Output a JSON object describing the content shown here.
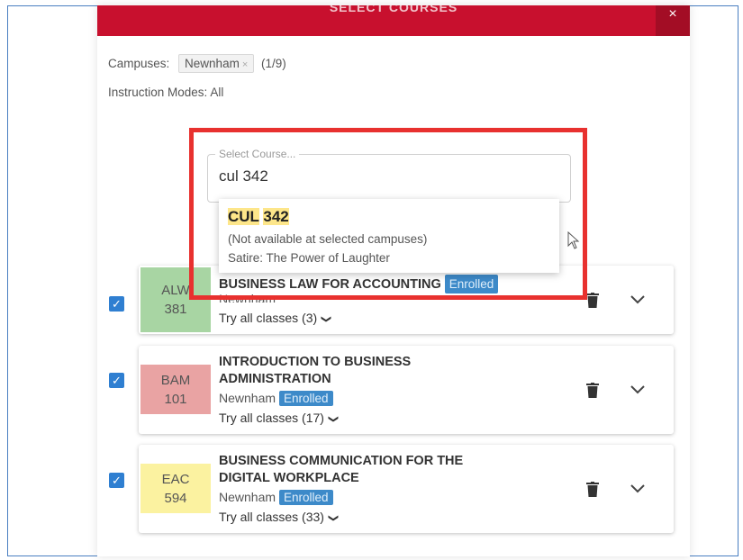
{
  "header": {
    "title": "SELECT COURSES",
    "close_label": "×"
  },
  "filters": {
    "campuses_label": "Campuses:",
    "campus_chip": "Newnham",
    "campus_chip_remove": "×",
    "campus_count": "(1/9)",
    "modes_label": "Instruction Modes:",
    "modes_value": "All"
  },
  "search": {
    "label": "Select Course...",
    "value": "cul 342"
  },
  "suggestion": {
    "code_part1": "CUL",
    "code_part2": "342",
    "note": "(Not available at selected campuses)",
    "title": "Satire: The Power of Laughter"
  },
  "courses": [
    {
      "subject": "ALW",
      "number": "381",
      "title": "BUSINESS LAW FOR ACCOUNTING",
      "campus": "Newnham",
      "badge": "Enrolled",
      "try_all": "Try all classes (3)",
      "color": "#a8d5a3"
    },
    {
      "subject": "BAM",
      "number": "101",
      "title": "INTRODUCTION TO BUSINESS ADMINISTRATION",
      "campus": "Newnham",
      "badge": "Enrolled",
      "try_all": "Try all classes (17)",
      "color": "#e9a3a3"
    },
    {
      "subject": "EAC",
      "number": "594",
      "title": "BUSINESS COMMUNICATION FOR THE DIGITAL WORKPLACE",
      "campus": "Newnham",
      "badge": "Enrolled",
      "try_all": "Try all classes (33)",
      "color": "#fbf2a0"
    }
  ],
  "colors": {
    "header": "#c8102e",
    "annotation": "#e8312f",
    "badge": "#3d8ac9",
    "checkbox": "#2f7fd1",
    "match_highlight": "#fde68a"
  },
  "icons": {
    "delete": "trash-icon",
    "expand": "chevron-down-icon",
    "check": "checkmark-icon"
  }
}
